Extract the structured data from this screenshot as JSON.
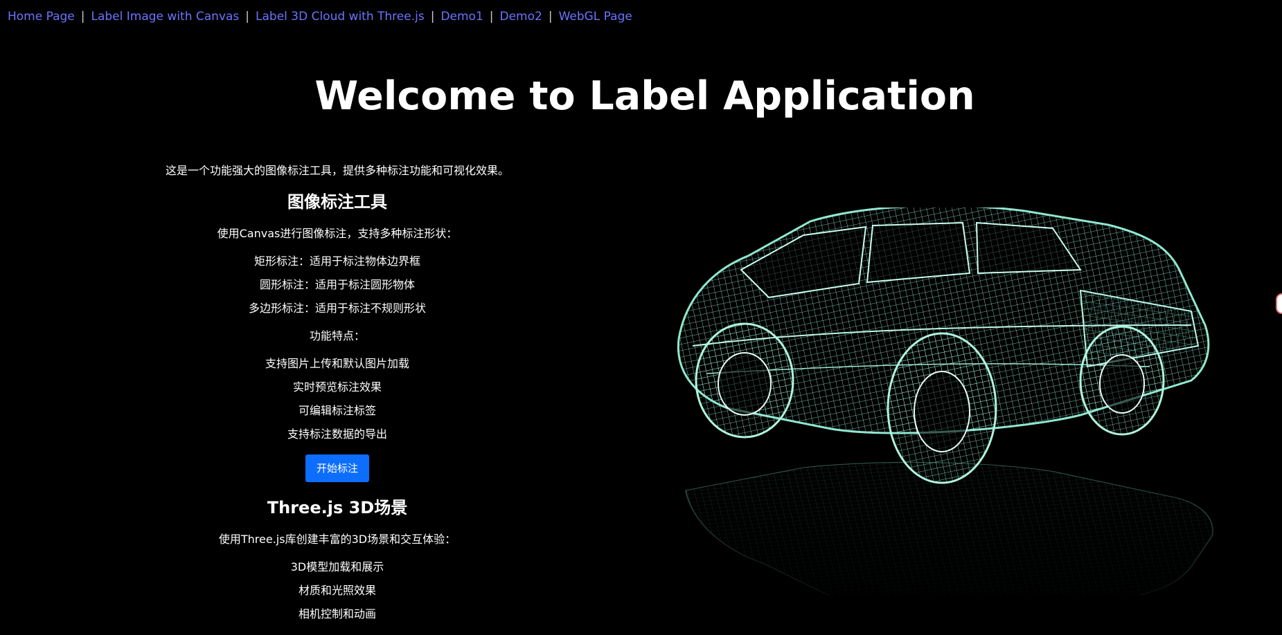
{
  "nav": {
    "links": [
      "Home Page",
      "Label Image with Canvas",
      "Label 3D Cloud with Three.js",
      "Demo1",
      "Demo2",
      "WebGL Page"
    ],
    "separator": "|",
    "link_color": "#6b74ff"
  },
  "page": {
    "title": "Welcome to Label Application"
  },
  "intro": "这是一个功能强大的图像标注工具，提供多种标注功能和可视化效果。",
  "section_image": {
    "heading": "图像标注工具",
    "desc": "使用Canvas进行图像标注，支持多种标注形状：",
    "shapes": [
      "矩形标注：适用于标注物体边界框",
      "圆形标注：适用于标注圆形物体",
      "多边形标注：适用于标注不规则形状"
    ],
    "features_title": "功能特点：",
    "features": [
      "支持图片上传和默认图片加载",
      "实时预览标注效果",
      "可编辑标注标签",
      "支持标注数据的导出"
    ],
    "start_button": "开始标注"
  },
  "section_three": {
    "heading": "Three.js 3D场景",
    "desc": "使用Three.js库创建丰富的3D场景和交互体验：",
    "items": [
      "3D模型加载和展示",
      "材质和光照效果",
      "相机控制和动画"
    ]
  },
  "colors": {
    "background": "#000000",
    "button": "#0d6efd",
    "wireframe": "#7fd9c0"
  }
}
